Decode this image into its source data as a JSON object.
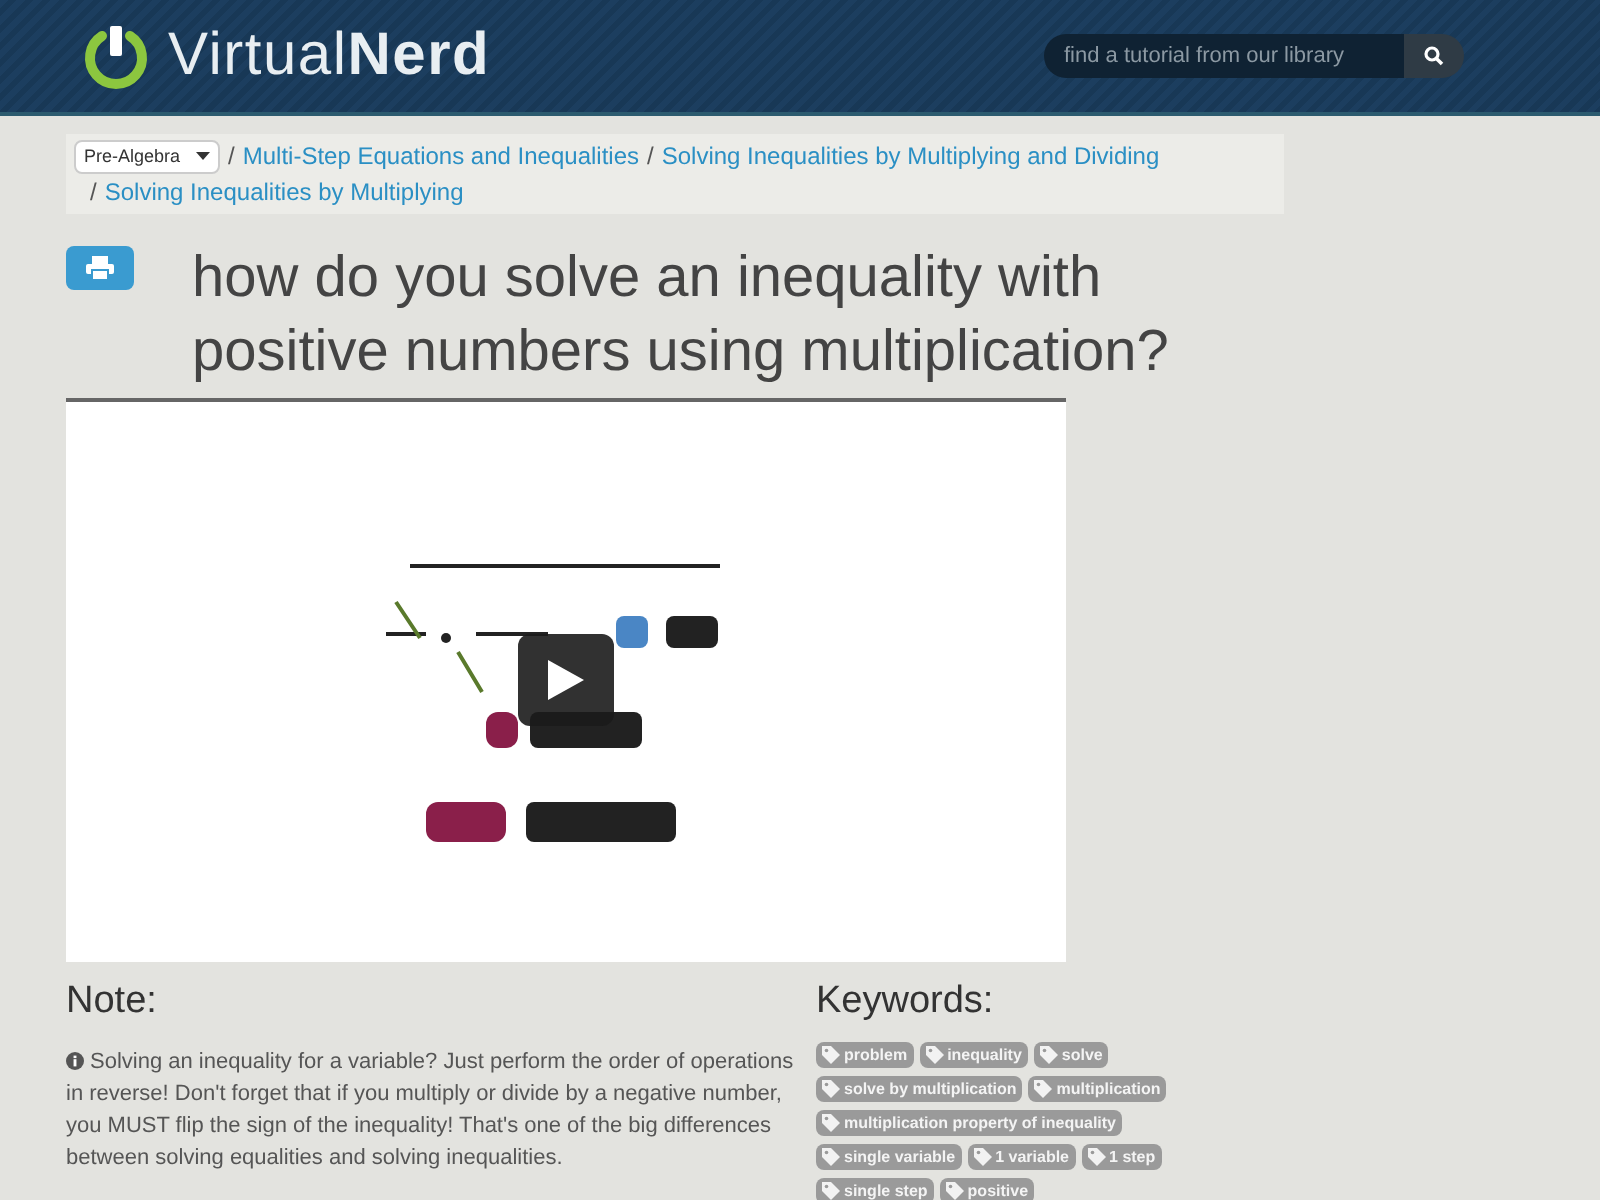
{
  "header": {
    "logo": {
      "light": "Virtual",
      "bold": "Nerd"
    },
    "search": {
      "placeholder": "find a tutorial from our library"
    }
  },
  "breadcrumb": {
    "subject": "Pre-Algebra",
    "links": [
      {
        "separator": "/",
        "label": "Multi-Step Equations and Inequalities"
      },
      {
        "separator": "/",
        "label": "Solving Inequalities by Multiplying and Dividing"
      },
      {
        "separator": "/",
        "label": "Solving Inequalities by Multiplying"
      }
    ]
  },
  "title": "how do you solve an inequality with positive numbers using multiplication?",
  "note": {
    "heading": "Note:",
    "text": "Solving an inequality for a variable? Just perform the order of operations in reverse! Don't forget that if you multiply or divide by a negative number, you MUST flip the sign of the inequality! That's one of the big differences between solving equalities and solving inequalities."
  },
  "keywords": {
    "heading": "Keywords:",
    "tags": [
      "problem",
      "inequality",
      "solve",
      "solve by multiplication",
      "multiplication",
      "multiplication property of inequality",
      "single variable",
      "1 variable",
      "1 step",
      "single step",
      "positive"
    ]
  }
}
